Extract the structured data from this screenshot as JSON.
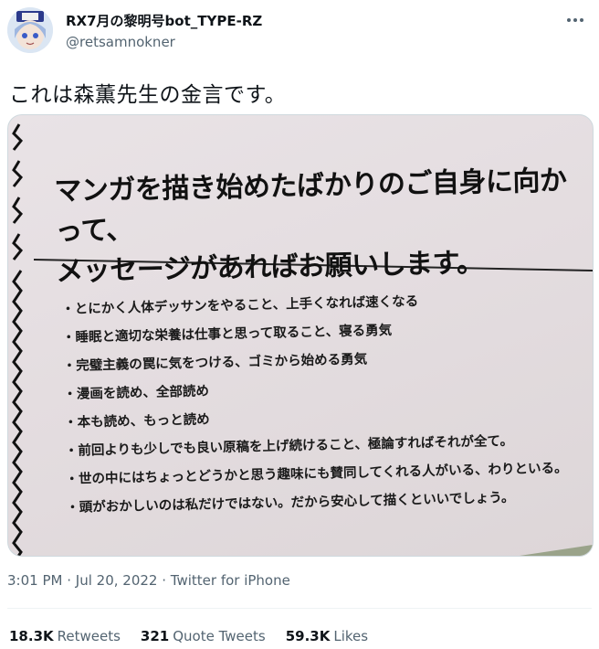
{
  "author": {
    "display_name": "RX7月の黎明号bot_TYPE-RZ",
    "handle": "@retsamnokner"
  },
  "tweet": {
    "text": "これは森薫先生の金言です。"
  },
  "photo": {
    "heading_line1": "マンガを描き始めたばかりのご自身に向かって、",
    "heading_line2": "メッセージがあればお願いします。",
    "items": [
      "・とにかく人体デッサンをやること、上手くなれば速くなる",
      "・睡眠と適切な栄養は仕事と思って取ること、寝る勇気",
      "・完璧主義の罠に気をつける、ゴミから始める勇気",
      "・漫画を読め、全部読め",
      "・本も読め、もっと読め",
      "・前回よりも少しでも良い原稿を上げ続けること、極論すればそれが全て。",
      "・世の中にはちょっとどうかと思う趣味にも賛同してくれる人がいる、わりといる。",
      "・頭がおかしいのは私だけではない。だから安心して描くといいでしょう。"
    ]
  },
  "meta": {
    "time": "3:01 PM",
    "date": "Jul 20, 2022",
    "source": "Twitter for iPhone"
  },
  "stats": {
    "retweets_count": "18.3K",
    "retweets_label": "Retweets",
    "quotes_count": "321",
    "quotes_label": "Quote Tweets",
    "likes_count": "59.3K",
    "likes_label": "Likes"
  },
  "icons": {
    "more": "more-icon",
    "avatar": "avatar-image"
  }
}
